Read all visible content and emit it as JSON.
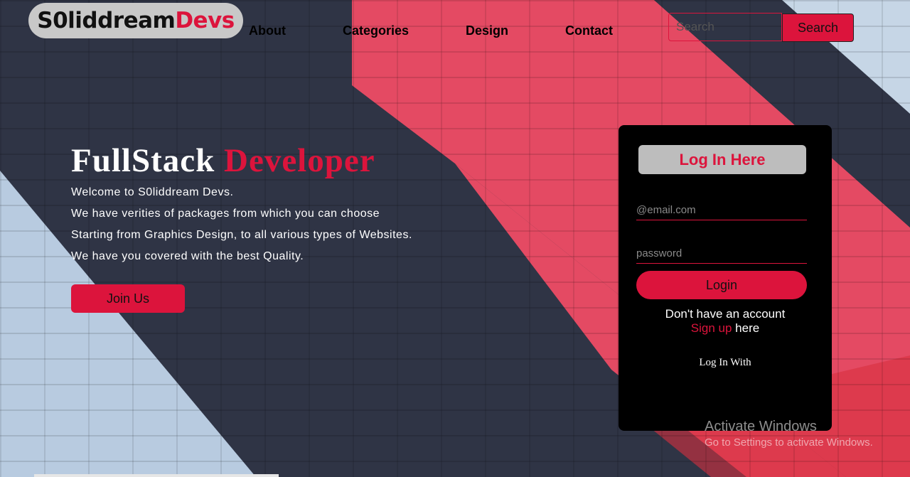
{
  "header": {
    "logo_part1": "S0liddream",
    "logo_part2": "Devs",
    "nav": [
      "About",
      "Categories",
      "Design",
      "Contact"
    ],
    "search_placeholder": "Search",
    "search_button": "Search"
  },
  "hero": {
    "title_part1": "FullStack",
    "title_part2": "Developer",
    "lines": [
      "Welcome to S0liddream Devs.",
      "We have verities of packages from which you can choose",
      "Starting from Graphics Design, to all various types of Websites.",
      "We have you covered with the best Quality."
    ],
    "join_button": "Join Us"
  },
  "login": {
    "heading": "Log In Here",
    "email_placeholder": "@email.com",
    "password_placeholder": "password",
    "login_button": "Login",
    "no_account": "Don't have an account",
    "signup_link": "Sign up",
    "signup_suffix": " here",
    "login_with": "Log In With"
  },
  "watermark": {
    "title": "Activate Windows",
    "subtitle": "Go to Settings to activate Windows."
  },
  "colors": {
    "accent": "#dc143c",
    "card": "#000000",
    "logo_bg": "#c8c8c8"
  }
}
